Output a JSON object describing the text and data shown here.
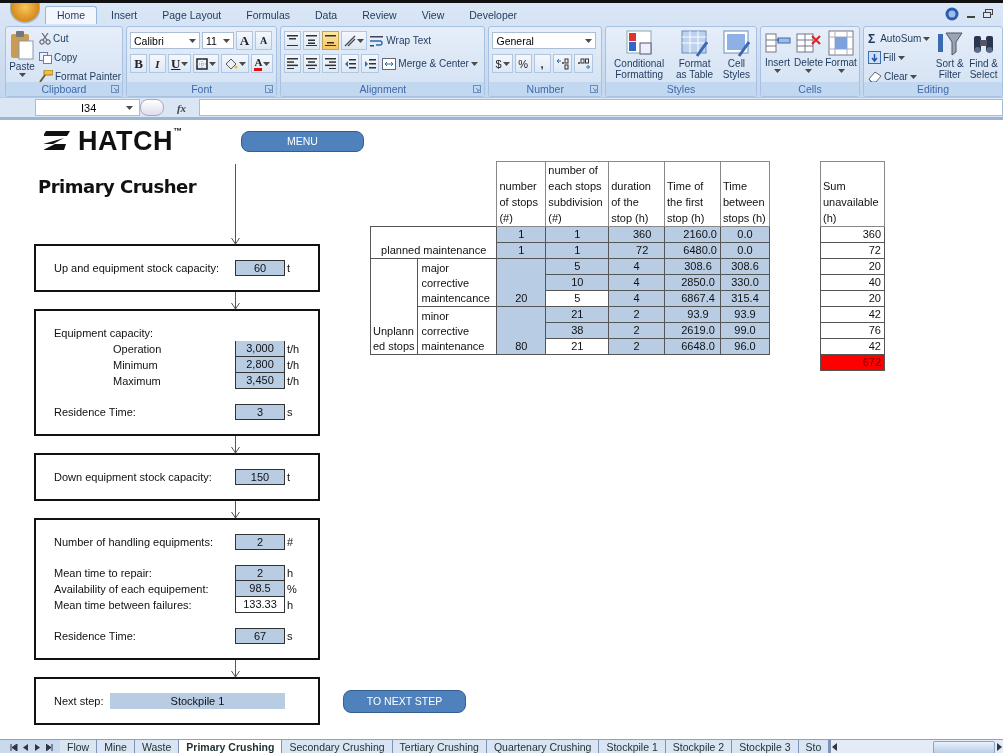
{
  "ribbon": {
    "tabs": [
      {
        "label": "Home",
        "selected": true
      },
      {
        "label": "Insert",
        "selected": false
      },
      {
        "label": "Page Layout",
        "selected": false
      },
      {
        "label": "Formulas",
        "selected": false
      },
      {
        "label": "Data",
        "selected": false
      },
      {
        "label": "Review",
        "selected": false
      },
      {
        "label": "View",
        "selected": false
      },
      {
        "label": "Developer",
        "selected": false
      }
    ],
    "clipboard": {
      "title": "Clipboard",
      "paste": "Paste",
      "cut": "Cut",
      "copy": "Copy",
      "format_painter": "Format Painter"
    },
    "font": {
      "title": "Font",
      "name": "Calibri",
      "size": "11",
      "grow": "A",
      "shrink": "A",
      "bold": "B",
      "italic": "I",
      "underline": "U",
      "font_color": "A"
    },
    "alignment": {
      "title": "Alignment",
      "vertical_align_buttons": [
        {
          "selected": false
        },
        {
          "selected": false
        },
        {
          "selected": true
        }
      ],
      "wrap_text": "Wrap Text",
      "merge": "Merge & Center"
    },
    "number": {
      "title": "Number",
      "format": "General",
      "currency": "$",
      "percent": "%",
      "comma": ","
    },
    "styles": {
      "title": "Styles",
      "buttons": [
        "Conditional Formatting",
        "Format as Table",
        "Cell Styles"
      ]
    },
    "cells": {
      "title": "Cells",
      "buttons": [
        "Insert",
        "Delete",
        "Format"
      ]
    },
    "editing": {
      "title": "Editing",
      "autosum_symbol": "Σ",
      "autosum": "AutoSum",
      "fill": "Fill",
      "clear": "Clear",
      "sort": "Sort & Filter",
      "find": "Find & Select"
    }
  },
  "formula_bar": {
    "name_box": "I34",
    "function_label": "fx"
  },
  "sheet": {
    "logo": "HATCH$^{™}$",
    "menu_button": "MENU",
    "title": "Primary Crusher",
    "steps": [
      {
        "groups": [
          [
            {
              "kind": "main",
              "label": "Up and equipment stock capacity:",
              "value": "60",
              "unit": "t",
              "highlighted": true
            }
          ]
        ]
      },
      {
        "groups": [
          [
            {
              "kind": "heading",
              "label": "Equipment capacity:"
            },
            {
              "kind": "sub",
              "label": "Operation",
              "value": "3,000",
              "unit": "t/h",
              "highlighted": true
            },
            {
              "kind": "sub",
              "label": "Minimum",
              "value": "2,800",
              "unit": "t/h",
              "highlighted": true
            },
            {
              "kind": "sub",
              "label": "Maximum",
              "value": "3,450",
              "unit": "t/h",
              "highlighted": true
            }
          ],
          [
            {
              "kind": "main",
              "label": "Residence Time:",
              "value": "3",
              "unit": "s",
              "highlighted": true
            }
          ]
        ]
      },
      {
        "groups": [
          [
            {
              "kind": "main",
              "label": "Down equipment stock capacity:",
              "value": "150",
              "unit": "t",
              "highlighted": true
            }
          ]
        ]
      },
      {
        "groups": [
          [
            {
              "kind": "main",
              "label": "Number of handling equipments:",
              "value": "2",
              "unit": "#",
              "highlighted": true
            }
          ],
          [
            {
              "kind": "main",
              "label": "Mean time to repair:",
              "value": "2",
              "unit": "h",
              "highlighted": true
            },
            {
              "kind": "main",
              "label": "Availability of each equipement:",
              "value": "98.5",
              "unit": "%",
              "highlighted": true
            },
            {
              "kind": "main",
              "label": "Mean time between failures:",
              "value": "133.33",
              "unit": "h",
              "highlighted": false
            }
          ],
          [
            {
              "kind": "main",
              "label": "Residence Time:",
              "value": "67",
              "unit": "s",
              "highlighted": true
            }
          ]
        ]
      }
    ],
    "next_step": {
      "label": "Next step:",
      "value": "Stockpile 1"
    },
    "next_button": "TO NEXT STEP"
  },
  "stops_table": {
    "columns": [
      "number of stops (#)",
      "number of each stops subdivision (#)",
      "duration of the stop (h)",
      "Time of the first stop (h)",
      "Time between stops (h)"
    ],
    "planned": {
      "label": "planned maintenance",
      "rows": [
        {
          "stops": "1",
          "subdivision": "1",
          "duration": "360",
          "first_stop": "2160.0",
          "between": "0.0"
        },
        {
          "stops": "1",
          "subdivision": "1",
          "duration": "72",
          "first_stop": "6480.0",
          "between": "0.0"
        }
      ]
    },
    "unplanned": {
      "label": "Unplanned stops",
      "groups": [
        {
          "label": "major corrective maintencance",
          "stops": "20",
          "rows": [
            {
              "subdivision": "5",
              "highlighted": true,
              "duration": "4",
              "first_stop": "308.6",
              "between": "308.6"
            },
            {
              "subdivision": "10",
              "highlighted": true,
              "duration": "4",
              "first_stop": "2850.0",
              "between": "330.0"
            },
            {
              "subdivision": "5",
              "highlighted": false,
              "duration": "4",
              "first_stop": "6867.4",
              "between": "315.4"
            }
          ]
        },
        {
          "label": "minor corrective maintenance",
          "stops": "80",
          "rows": [
            {
              "subdivision": "21",
              "highlighted": true,
              "duration": "2",
              "first_stop": "93.9",
              "between": "93.9"
            },
            {
              "subdivision": "38",
              "highlighted": true,
              "duration": "2",
              "first_stop": "2619.0",
              "between": "99.0"
            },
            {
              "subdivision": "21",
              "highlighted": false,
              "duration": "2",
              "first_stop": "6648.0",
              "between": "96.0"
            }
          ]
        }
      ]
    }
  },
  "sum_table": {
    "header": "Sum unavailable (h)",
    "values": [
      "360",
      "72",
      "20",
      "40",
      "20",
      "42",
      "76",
      "42"
    ],
    "total": "672",
    "alert": true
  },
  "sheet_tabs": [
    {
      "label": "Flow",
      "selected": false
    },
    {
      "label": "Mine",
      "selected": false
    },
    {
      "label": "Waste",
      "selected": false
    },
    {
      "label": "Primary Crushing",
      "selected": true
    },
    {
      "label": "Secondary Crushing",
      "selected": false
    },
    {
      "label": "Tertiary Crushing",
      "selected": false
    },
    {
      "label": "Quartenary Crushing",
      "selected": false
    },
    {
      "label": "Stockpile 1",
      "selected": false
    },
    {
      "label": "Stockpile 2",
      "selected": false
    },
    {
      "label": "Stockpile 3",
      "selected": false
    },
    {
      "label": "Sto",
      "selected": false
    }
  ]
}
